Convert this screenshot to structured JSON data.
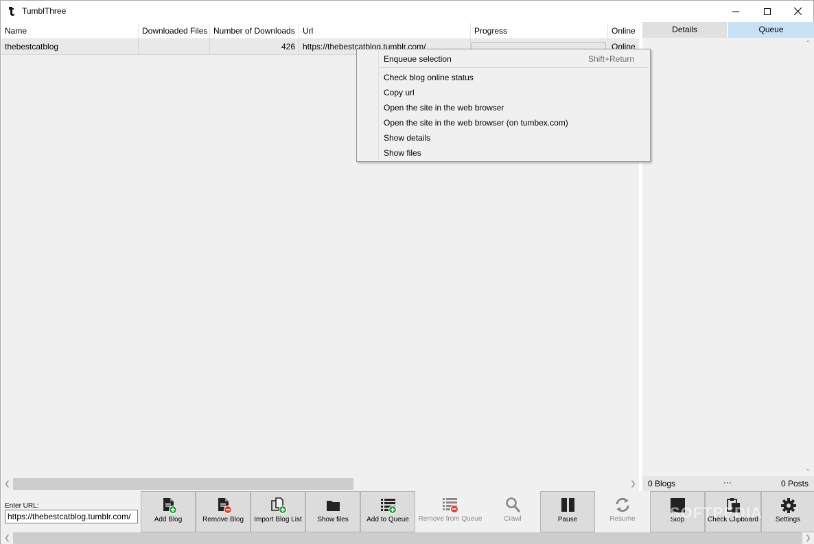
{
  "window": {
    "title": "TumblThree"
  },
  "grid": {
    "columns": [
      "Name",
      "Downloaded Files",
      "Number of Downloads",
      "Url",
      "Progress",
      "Online"
    ],
    "rows": [
      {
        "name": "thebestcatblog",
        "downloaded_files": "",
        "number_of_downloads": "426",
        "url": "https://thebestcatblog.tumblr.com/",
        "progress": 0,
        "online": "Online"
      }
    ]
  },
  "context_menu": {
    "items": [
      {
        "label": "Enqueue selection",
        "shortcut": "Shift+Return"
      },
      {
        "label": "Check blog online status"
      },
      {
        "label": "Copy url"
      },
      {
        "label": "Open the site in the web browser"
      },
      {
        "label": "Open the site in the web browser (on tumbex.com)"
      },
      {
        "label": "Show details"
      },
      {
        "label": "Show files"
      }
    ]
  },
  "right_panel": {
    "tabs": [
      "Details",
      "Queue"
    ],
    "active_tab": "Queue",
    "status": {
      "blogs": "0 Blogs",
      "ellipsis": "···",
      "posts": "0 Posts"
    }
  },
  "bottom": {
    "url_label": "Enter URL:",
    "url_value": "https://thebestcatblog.tumblr.com/",
    "buttons": [
      {
        "label": "Add Blog",
        "icon": "add-blog-icon"
      },
      {
        "label": "Remove Blog",
        "icon": "remove-blog-icon"
      },
      {
        "label": "Import Blog List",
        "icon": "import-list-icon"
      },
      {
        "label": "Show files",
        "icon": "folder-icon"
      },
      {
        "label": "Add to Queue",
        "icon": "add-queue-icon"
      },
      {
        "label": "Remove from Queue",
        "icon": "remove-queue-icon"
      },
      {
        "label": "Crawl",
        "icon": "search-icon"
      },
      {
        "label": "Pause",
        "icon": "pause-icon"
      },
      {
        "label": "Resume",
        "icon": "refresh-icon"
      },
      {
        "label": "Stop",
        "icon": "stop-icon"
      },
      {
        "label": "Check Clipboard",
        "icon": "clipboard-icon"
      },
      {
        "label": "Settings",
        "icon": "gear-icon"
      }
    ],
    "watermark": "SOFTPEDIA"
  },
  "colors": {
    "accent_tab": "#c8e1f4",
    "add_green": "#1aa33b",
    "remove_red": "#e2402b",
    "progress_green": "#06b025"
  }
}
